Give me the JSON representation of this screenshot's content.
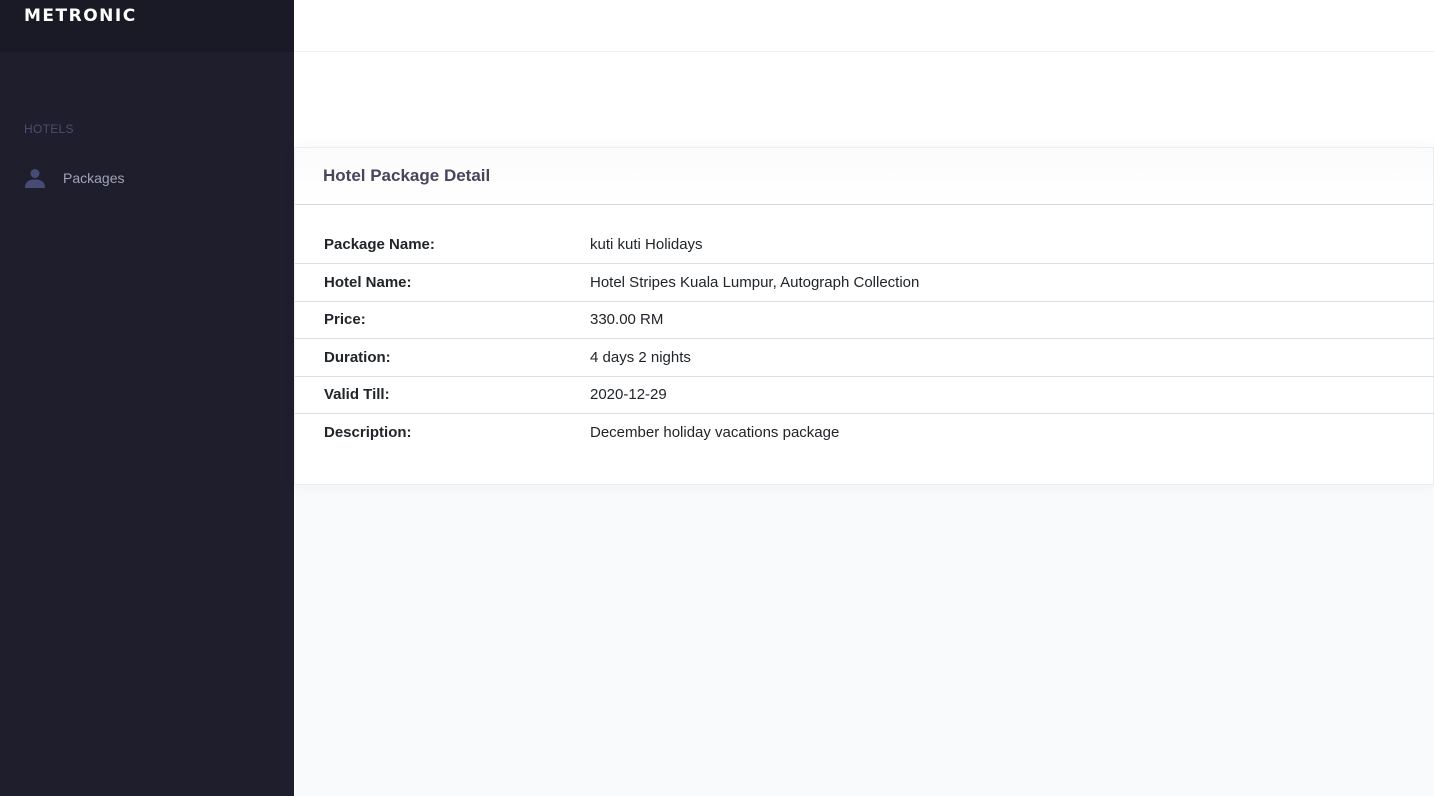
{
  "brand": {
    "logo_text": "METRONIC"
  },
  "sidebar": {
    "section_title": "HOTELS",
    "items": [
      {
        "label": "Packages",
        "icon": "user-icon"
      }
    ]
  },
  "card": {
    "title": "Hotel Package Detail",
    "rows": [
      {
        "label": "Package Name:",
        "value": "kuti kuti Holidays"
      },
      {
        "label": "Hotel Name:",
        "value": "Hotel Stripes Kuala Lumpur, Autograph Collection"
      },
      {
        "label": "Price:",
        "value": "330.00 RM"
      },
      {
        "label": "Duration:",
        "value": "4 days 2 nights"
      },
      {
        "label": "Valid Till:",
        "value": "2020-12-29"
      },
      {
        "label": "Description:",
        "value": "December holiday vacations package"
      }
    ]
  },
  "colors": {
    "sidebar_bg": "#1e1e2d",
    "brand_bg": "#1a1a27",
    "menu_text": "#a2a3b7",
    "icon_color": "#494b74",
    "page_bg": "#f9fafb"
  }
}
